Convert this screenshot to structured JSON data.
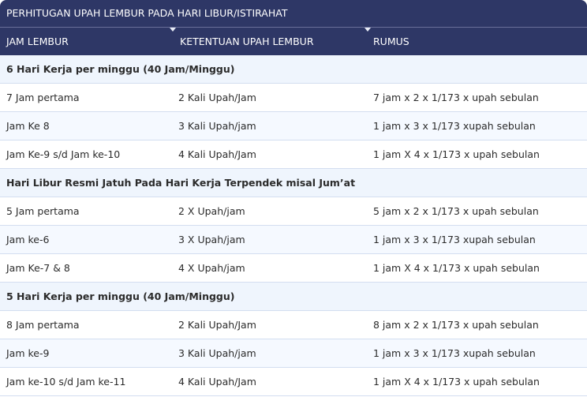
{
  "title": "PERHITUGAN UPAH LEMBUR PADA HARI LIBUR/ISTIRAHAT",
  "headers": [
    "JAM LEMBUR",
    "KETENTUAN UPAH LEMBUR",
    "RUMUS"
  ],
  "sections": [
    {
      "heading": "6 Hari Kerja per minggu (40 Jam/Minggu)",
      "rows": [
        [
          "7 Jam pertama",
          "2 Kali Upah/Jam",
          "7 jam x 2 x 1/173 x upah sebulan"
        ],
        [
          "Jam Ke 8",
          "3 Kali Upah/jam",
          "1 jam x 3 x 1/173 xupah sebulan"
        ],
        [
          "Jam Ke-9 s/d Jam ke-10",
          "4 Kali Upah/Jam",
          "1 jam X 4 x 1/173 x upah sebulan"
        ]
      ]
    },
    {
      "heading": "Hari Libur Resmi Jatuh Pada Hari Kerja Terpendek misal Jum’at",
      "rows": [
        [
          "5 Jam pertama",
          "2 X Upah/jam",
          "5 jam x 2 x 1/173 x upah sebulan"
        ],
        [
          "Jam ke-6",
          "3 X Upah/jam",
          "1 jam x 3 x 1/173 xupah sebulan"
        ],
        [
          "Jam Ke-7 & 8",
          "4 X Upah/jam",
          "1 jam X 4 x 1/173 x upah sebulan"
        ]
      ]
    },
    {
      "heading": "5 Hari Kerja per minggu (40 Jam/Minggu)",
      "rows": [
        [
          "8 Jam pertama",
          "2 Kali Upah/Jam",
          "8 jam x 2 x 1/173 x upah sebulan"
        ],
        [
          "Jam ke-9",
          "3 Kali Upah/jam",
          "1 jam x 3 x 1/173 xupah sebulan"
        ],
        [
          "Jam ke-10 s/d Jam ke-11",
          "4 Kali Upah/Jam",
          "1 jam X 4 x 1/173 x upah sebulan"
        ]
      ]
    }
  ]
}
